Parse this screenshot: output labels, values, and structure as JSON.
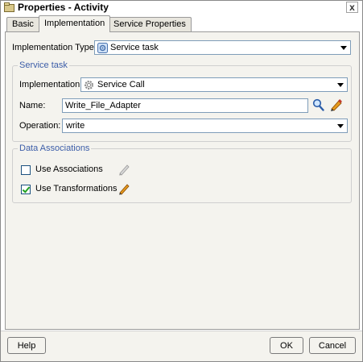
{
  "window": {
    "title": "Properties - Activity",
    "close_glyph": "x"
  },
  "tabs": [
    {
      "label": "Basic",
      "active": false
    },
    {
      "label": "Implementation",
      "active": true
    },
    {
      "label": "Service Properties",
      "active": false
    }
  ],
  "implementation_type": {
    "label": "Implementation Type:",
    "value": "Service task",
    "icon": "service-task-icon"
  },
  "service_task": {
    "group_title": "Service task",
    "implementation_label": "Implementation:",
    "implementation_value": "Service Call",
    "implementation_icon": "gear-icon",
    "name_label": "Name:",
    "name_value": "Write_File_Adapter",
    "operation_label": "Operation:",
    "operation_value": "write"
  },
  "data_associations": {
    "group_title": "Data Associations",
    "use_associations_label": "Use Associations",
    "use_associations_checked": false,
    "use_transformations_label": "Use Transformations",
    "use_transformations_checked": true
  },
  "buttons": {
    "help": "Help",
    "ok": "OK",
    "cancel": "Cancel"
  },
  "colors": {
    "accent_blue": "#3c5da8",
    "panel_bg": "#f4f3ee",
    "pencil_orange": "#e59a1e"
  }
}
